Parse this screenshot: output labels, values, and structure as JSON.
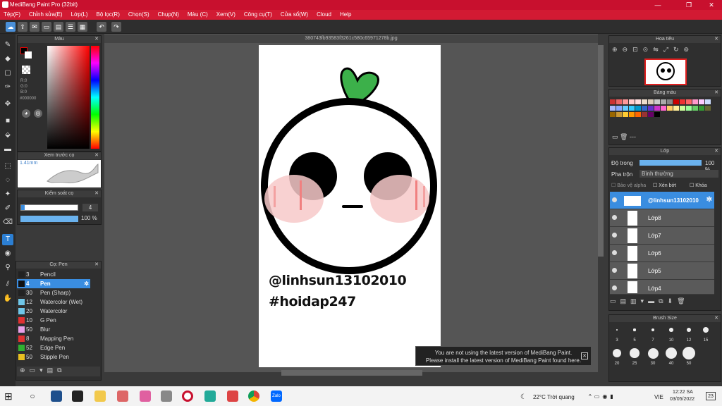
{
  "app": {
    "title": "MediBang Paint Pro (32bit)",
    "document": "380743fb93583f3261c580c65971278b.jpg"
  },
  "menu": [
    "Tệp(F)",
    "Chỉnh sửa(E)",
    "Lớp(L)",
    "Bộ lọc(R)",
    "Chọn(S)",
    "Chụp(N)",
    "Màu (C)",
    "Xem(V)",
    "Công cụ(T)",
    "Cửa sổ(W)",
    "Cloud",
    "Help"
  ],
  "color_panel": {
    "title": "Màu",
    "r": "R:0",
    "g": "G:0",
    "b": "B:0",
    "hex": "#000000"
  },
  "brush_preview": {
    "title": "Xem trước cọ",
    "size": "1.41mm"
  },
  "brush_control": {
    "title": "Kiểm soát cọ",
    "size": "4",
    "opacity": "100 %"
  },
  "brush_list": {
    "title": "Cọ: Pen",
    "items": [
      {
        "n": "3",
        "name": "Pencil",
        "color": "#222222"
      },
      {
        "n": "4",
        "name": "Pen",
        "color": "#111111",
        "selected": true
      },
      {
        "n": "30",
        "name": "Pen (Sharp)",
        "color": "#222222"
      },
      {
        "n": "12",
        "name": "Watercolor (Wet)",
        "color": "#6fc6e8"
      },
      {
        "n": "20",
        "name": "Watercolor",
        "color": "#6fc6e8"
      },
      {
        "n": "10",
        "name": "G Pen",
        "color": "#e03030"
      },
      {
        "n": "50",
        "name": "Blur",
        "color": "#e8a0e8"
      },
      {
        "n": "8",
        "name": "Mapping Pen",
        "color": "#e03030"
      },
      {
        "n": "52",
        "name": "Edge Pen",
        "color": "#30b030"
      },
      {
        "n": "50",
        "name": "Stipple Pen",
        "color": "#e8c020"
      }
    ]
  },
  "navigator": {
    "title": "Hoa tiêu"
  },
  "palette": {
    "title": "Bảng màu",
    "extra": "---"
  },
  "layers": {
    "title": "Lớp",
    "opacity_label": "Độ trong",
    "opacity": "100 %",
    "blend_label": "Pha trộn",
    "blend": "Bình thường",
    "protect_alpha": "Bảo vệ alpha",
    "clip": "Xén bớt",
    "lock": "Khóa",
    "items": [
      "@linhsun13102010",
      "Lớp8",
      "Lớp7",
      "Lớp6",
      "Lớp5",
      "Lớp4"
    ]
  },
  "brush_size": {
    "title": "Brush Size",
    "row1": [
      "3",
      "5",
      "7",
      "10",
      "12",
      "15"
    ],
    "row2": [
      "20",
      "25",
      "30",
      "40",
      "50"
    ]
  },
  "artwork": {
    "line1": "@linhsun13102010",
    "line2": "#hoidap247"
  },
  "notification": {
    "line1": "You are not using the latest version of MediBang Paint.",
    "line2": "Please install the latest version of MediBang Paint found here."
  },
  "taskbar": {
    "weather": "22°C  Trời quang",
    "lang": "VIE",
    "time": "12:22 SA",
    "date": "03/05/2022",
    "badge": "23"
  }
}
